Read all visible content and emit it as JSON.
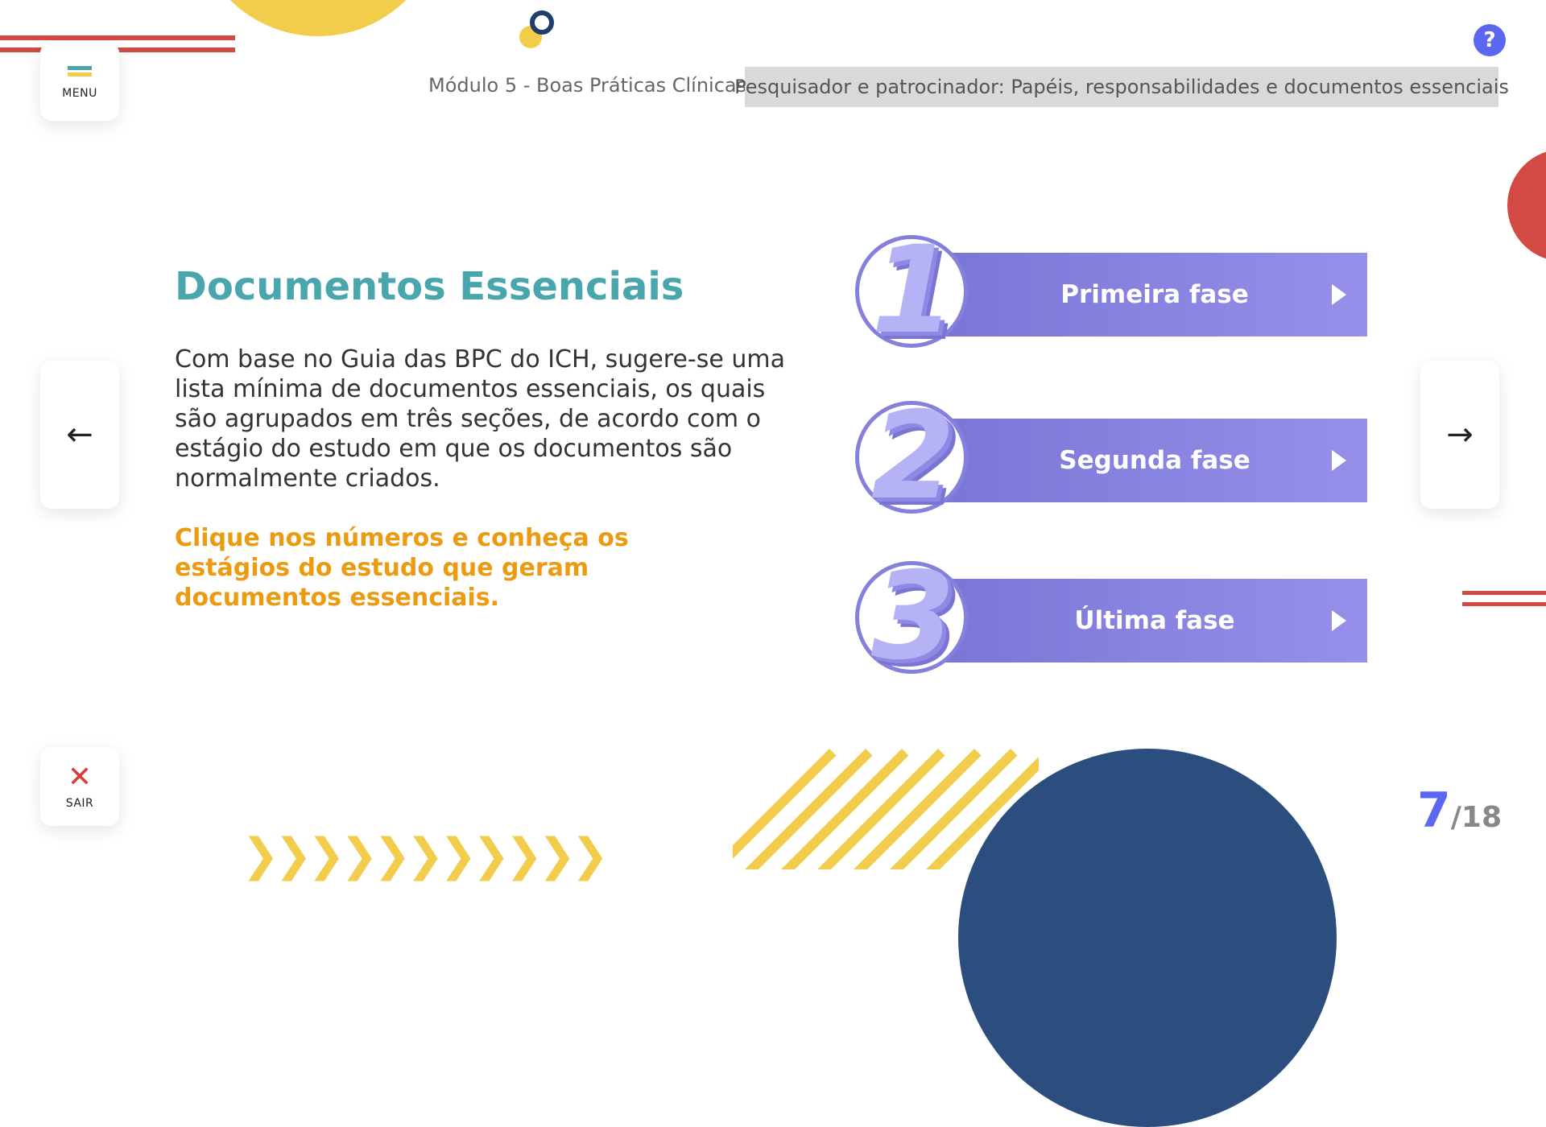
{
  "header": {
    "module_title": "Módulo 5 - Boas Práticas Clínicas",
    "lesson_title": "Pesquisador e patrocinador: Papéis, responsabilidades e documentos essenciais",
    "help_label": "?"
  },
  "nav": {
    "menu_label": "MENU",
    "exit_label": "SAIR",
    "prev_arrow": "←",
    "next_arrow": "→",
    "exit_symbol": "✕"
  },
  "content": {
    "heading": "Documentos Essenciais",
    "paragraph": "Com base no Guia das BPC do ICH, sugere-se uma lista mínima de documentos essenciais, os quais são agrupados em três seções, de acordo com o estágio do estudo em que os documentos são normalmente criados.",
    "cta": "Clique nos números e conheça os estágios do estudo que geram documentos essenciais."
  },
  "phases": [
    {
      "number": "1",
      "label": "Primeira fase"
    },
    {
      "number": "2",
      "label": "Segunda fase"
    },
    {
      "number": "3",
      "label": "Última fase"
    }
  ],
  "pagination": {
    "current": "7",
    "total": "/18"
  },
  "colors": {
    "accent_teal": "#4aa6ad",
    "accent_orange": "#ec9a10",
    "phase_purple": "#8580dc",
    "help_blue": "#5b67f0",
    "deco_red": "#d24a43",
    "deco_yellow": "#f2cd4b",
    "deco_navy": "#2c4e7e"
  }
}
